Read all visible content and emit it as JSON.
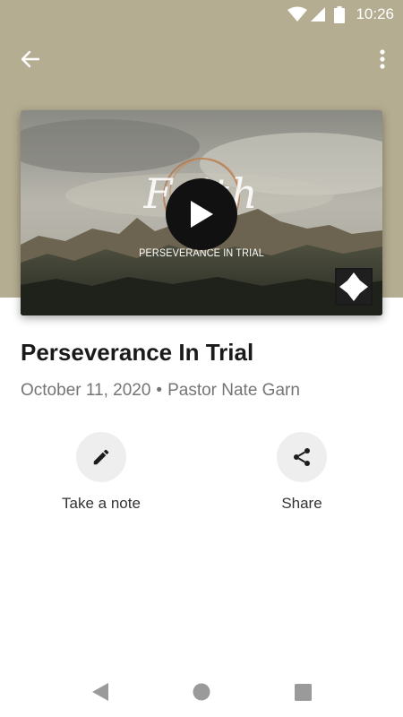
{
  "status_bar": {
    "time": "10:26",
    "icons": [
      "wifi-icon",
      "cell-signal-icon",
      "battery-icon"
    ]
  },
  "top_bar": {
    "back_icon": "arrow-left-icon",
    "more_icon": "more-vertical-icon"
  },
  "video": {
    "logo_text": "Faith",
    "series_title": "PERSEVERANCE IN TRIAL",
    "play_icon": "play-icon",
    "fullscreen_icon": "fullscreen-icon"
  },
  "sermon": {
    "title": "Perseverance In Trial",
    "date": "October 11, 2020",
    "separator": "•",
    "speaker": "Pastor Nate Garn"
  },
  "actions": [
    {
      "label": "Take a note",
      "icon": "pencil-icon"
    },
    {
      "label": "Share",
      "icon": "share-icon"
    }
  ],
  "nav": {
    "icons": [
      "back-triangle-icon",
      "home-circle-icon",
      "recents-square-icon"
    ]
  },
  "colors": {
    "header_band": "#b5ad91",
    "action_circle": "#eeeeee",
    "meta_text": "#757575"
  }
}
